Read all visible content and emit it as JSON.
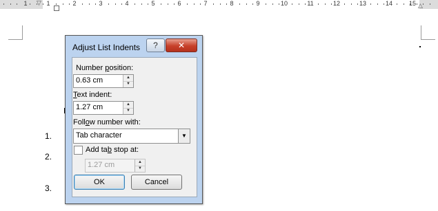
{
  "ruler": {
    "numbers": [
      "1",
      "1",
      "2",
      "3",
      "4",
      "5",
      "6",
      "7",
      "8",
      "9",
      "10",
      "11",
      "12",
      "13",
      "14",
      "15"
    ]
  },
  "page": {
    "list_numbers": [
      "1.",
      "2.",
      "3."
    ]
  },
  "dialog": {
    "title": "Adjust List Indents",
    "help_glyph": "?",
    "close_glyph": "✕",
    "number_position": {
      "label_before": "Number ",
      "label_accel": "p",
      "label_after": "osition:",
      "value": "0.63 cm"
    },
    "text_indent": {
      "label_accel": "T",
      "label_after": "ext indent:",
      "value": "1.27 cm"
    },
    "follow_number": {
      "label_before": "Foll",
      "label_accel": "o",
      "label_after": "w number with:",
      "selected": "Tab character"
    },
    "add_tab_stop": {
      "label_before": "Add ta",
      "label_accel": "b",
      "label_after": " stop at:",
      "checked": false,
      "value": "1.27 cm"
    },
    "ok_label": "OK",
    "cancel_label": "Cancel"
  }
}
